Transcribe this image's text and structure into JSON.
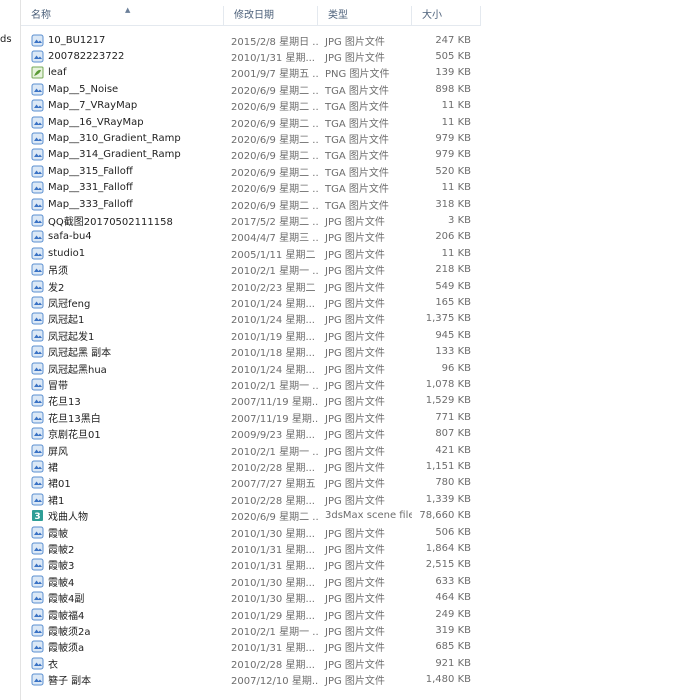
{
  "nav": {
    "cut_label": "ds"
  },
  "columns": {
    "name": "名称",
    "date": "修改日期",
    "type": "类型",
    "size": "大小"
  },
  "colors": {
    "accent": "#3a72c4",
    "header_text": "#4c607a",
    "detail_text": "#6d6d6d"
  },
  "rows": [
    {
      "name": "10_BU1217",
      "date": "2015/2/8 星期日 ...",
      "type": "JPG 图片文件",
      "size": "247 KB",
      "icon": "jpg-file-icon"
    },
    {
      "name": "200782223722",
      "date": "2010/1/31 星期...",
      "type": "JPG 图片文件",
      "size": "505 KB",
      "icon": "jpg-file-icon"
    },
    {
      "name": "leaf",
      "date": "2001/9/7 星期五 ...",
      "type": "PNG 图片文件",
      "size": "139 KB",
      "icon": "png-file-icon"
    },
    {
      "name": "Map__5_Noise",
      "date": "2020/6/9 星期二 ...",
      "type": "TGA 图片文件",
      "size": "898 KB",
      "icon": "tga-file-icon"
    },
    {
      "name": "Map__7_VRayMap",
      "date": "2020/6/9 星期二 ...",
      "type": "TGA 图片文件",
      "size": "11 KB",
      "icon": "tga-file-icon"
    },
    {
      "name": "Map__16_VRayMap",
      "date": "2020/6/9 星期二 ...",
      "type": "TGA 图片文件",
      "size": "11 KB",
      "icon": "tga-file-icon"
    },
    {
      "name": "Map__310_Gradient_Ramp",
      "date": "2020/6/9 星期二 ...",
      "type": "TGA 图片文件",
      "size": "979 KB",
      "icon": "tga-file-icon"
    },
    {
      "name": "Map__314_Gradient_Ramp",
      "date": "2020/6/9 星期二 ...",
      "type": "TGA 图片文件",
      "size": "979 KB",
      "icon": "tga-file-icon"
    },
    {
      "name": "Map__315_Falloff",
      "date": "2020/6/9 星期二 ...",
      "type": "TGA 图片文件",
      "size": "520 KB",
      "icon": "tga-file-icon"
    },
    {
      "name": "Map__331_Falloff",
      "date": "2020/6/9 星期二 ...",
      "type": "TGA 图片文件",
      "size": "11 KB",
      "icon": "tga-file-icon"
    },
    {
      "name": "Map__333_Falloff",
      "date": "2020/6/9 星期二 ...",
      "type": "TGA 图片文件",
      "size": "318 KB",
      "icon": "tga-file-icon"
    },
    {
      "name": "QQ截图20170502111158",
      "date": "2017/5/2 星期二 ...",
      "type": "JPG 图片文件",
      "size": "3 KB",
      "icon": "jpg-file-icon"
    },
    {
      "name": "safa-bu4",
      "date": "2004/4/7 星期三 ...",
      "type": "JPG 图片文件",
      "size": "206 KB",
      "icon": "jpg-file-icon"
    },
    {
      "name": "studio1",
      "date": "2005/1/11 星期二 ...",
      "type": "JPG 图片文件",
      "size": "11 KB",
      "icon": "jpg-file-icon"
    },
    {
      "name": "吊须",
      "date": "2010/2/1 星期一 ...",
      "type": "JPG 图片文件",
      "size": "218 KB",
      "icon": "jpg-file-icon"
    },
    {
      "name": "发2",
      "date": "2010/2/23 星期二 ...",
      "type": "JPG 图片文件",
      "size": "549 KB",
      "icon": "jpg-file-icon"
    },
    {
      "name": "凤冠feng",
      "date": "2010/1/24 星期...",
      "type": "JPG 图片文件",
      "size": "165 KB",
      "icon": "jpg-file-icon"
    },
    {
      "name": "凤冠起1",
      "date": "2010/1/24 星期...",
      "type": "JPG 图片文件",
      "size": "1,375 KB",
      "icon": "jpg-file-icon"
    },
    {
      "name": "凤冠起发1",
      "date": "2010/1/19 星期...",
      "type": "JPG 图片文件",
      "size": "945 KB",
      "icon": "jpg-file-icon"
    },
    {
      "name": "凤冠起黑 副本",
      "date": "2010/1/18 星期...",
      "type": "JPG 图片文件",
      "size": "133 KB",
      "icon": "jpg-file-icon"
    },
    {
      "name": "凤冠起黑hua",
      "date": "2010/1/24 星期...",
      "type": "JPG 图片文件",
      "size": "96 KB",
      "icon": "jpg-file-icon"
    },
    {
      "name": "冒带",
      "date": "2010/2/1 星期一 ...",
      "type": "JPG 图片文件",
      "size": "1,078 KB",
      "icon": "jpg-file-icon"
    },
    {
      "name": "花旦13",
      "date": "2007/11/19 星期...",
      "type": "JPG 图片文件",
      "size": "1,529 KB",
      "icon": "jpg-file-icon"
    },
    {
      "name": "花旦13黑白",
      "date": "2007/11/19 星期...",
      "type": "JPG 图片文件",
      "size": "771 KB",
      "icon": "jpg-file-icon"
    },
    {
      "name": "京剧花旦01",
      "date": "2009/9/23 星期...",
      "type": "JPG 图片文件",
      "size": "807 KB",
      "icon": "jpg-file-icon"
    },
    {
      "name": "屏风",
      "date": "2010/2/1 星期一 ...",
      "type": "JPG 图片文件",
      "size": "421 KB",
      "icon": "jpg-file-icon"
    },
    {
      "name": "裙",
      "date": "2010/2/28 星期...",
      "type": "JPG 图片文件",
      "size": "1,151 KB",
      "icon": "jpg-file-icon"
    },
    {
      "name": "裙01",
      "date": "2007/7/27 星期五 ...",
      "type": "JPG 图片文件",
      "size": "780 KB",
      "icon": "jpg-file-icon"
    },
    {
      "name": "裙1",
      "date": "2010/2/28 星期...",
      "type": "JPG 图片文件",
      "size": "1,339 KB",
      "icon": "jpg-file-icon"
    },
    {
      "name": "戏曲人物",
      "date": "2020/6/9 星期二 ...",
      "type": "3dsMax scene file",
      "size": "78,660 KB",
      "icon": "3dsmax-file-icon"
    },
    {
      "name": "霞帔",
      "date": "2010/1/30 星期...",
      "type": "JPG 图片文件",
      "size": "506 KB",
      "icon": "jpg-file-icon"
    },
    {
      "name": "霞帔2",
      "date": "2010/1/31 星期...",
      "type": "JPG 图片文件",
      "size": "1,864 KB",
      "icon": "jpg-file-icon"
    },
    {
      "name": "霞帔3",
      "date": "2010/1/31 星期...",
      "type": "JPG 图片文件",
      "size": "2,515 KB",
      "icon": "jpg-file-icon"
    },
    {
      "name": "霞帔4",
      "date": "2010/1/30 星期...",
      "type": "JPG 图片文件",
      "size": "633 KB",
      "icon": "jpg-file-icon"
    },
    {
      "name": "霞帔4副",
      "date": "2010/1/30 星期...",
      "type": "JPG 图片文件",
      "size": "464 KB",
      "icon": "jpg-file-icon"
    },
    {
      "name": "霞帔福4",
      "date": "2010/1/29 星期...",
      "type": "JPG 图片文件",
      "size": "249 KB",
      "icon": "jpg-file-icon"
    },
    {
      "name": "霞帔须2a",
      "date": "2010/2/1 星期一 ...",
      "type": "JPG 图片文件",
      "size": "319 KB",
      "icon": "jpg-file-icon"
    },
    {
      "name": "霞帔须a",
      "date": "2010/1/31 星期...",
      "type": "JPG 图片文件",
      "size": "685 KB",
      "icon": "jpg-file-icon"
    },
    {
      "name": "衣",
      "date": "2010/2/28 星期...",
      "type": "JPG 图片文件",
      "size": "921 KB",
      "icon": "jpg-file-icon"
    },
    {
      "name": "簪子 副本",
      "date": "2007/12/10 星期...",
      "type": "JPG 图片文件",
      "size": "1,480 KB",
      "icon": "jpg-file-icon"
    }
  ]
}
